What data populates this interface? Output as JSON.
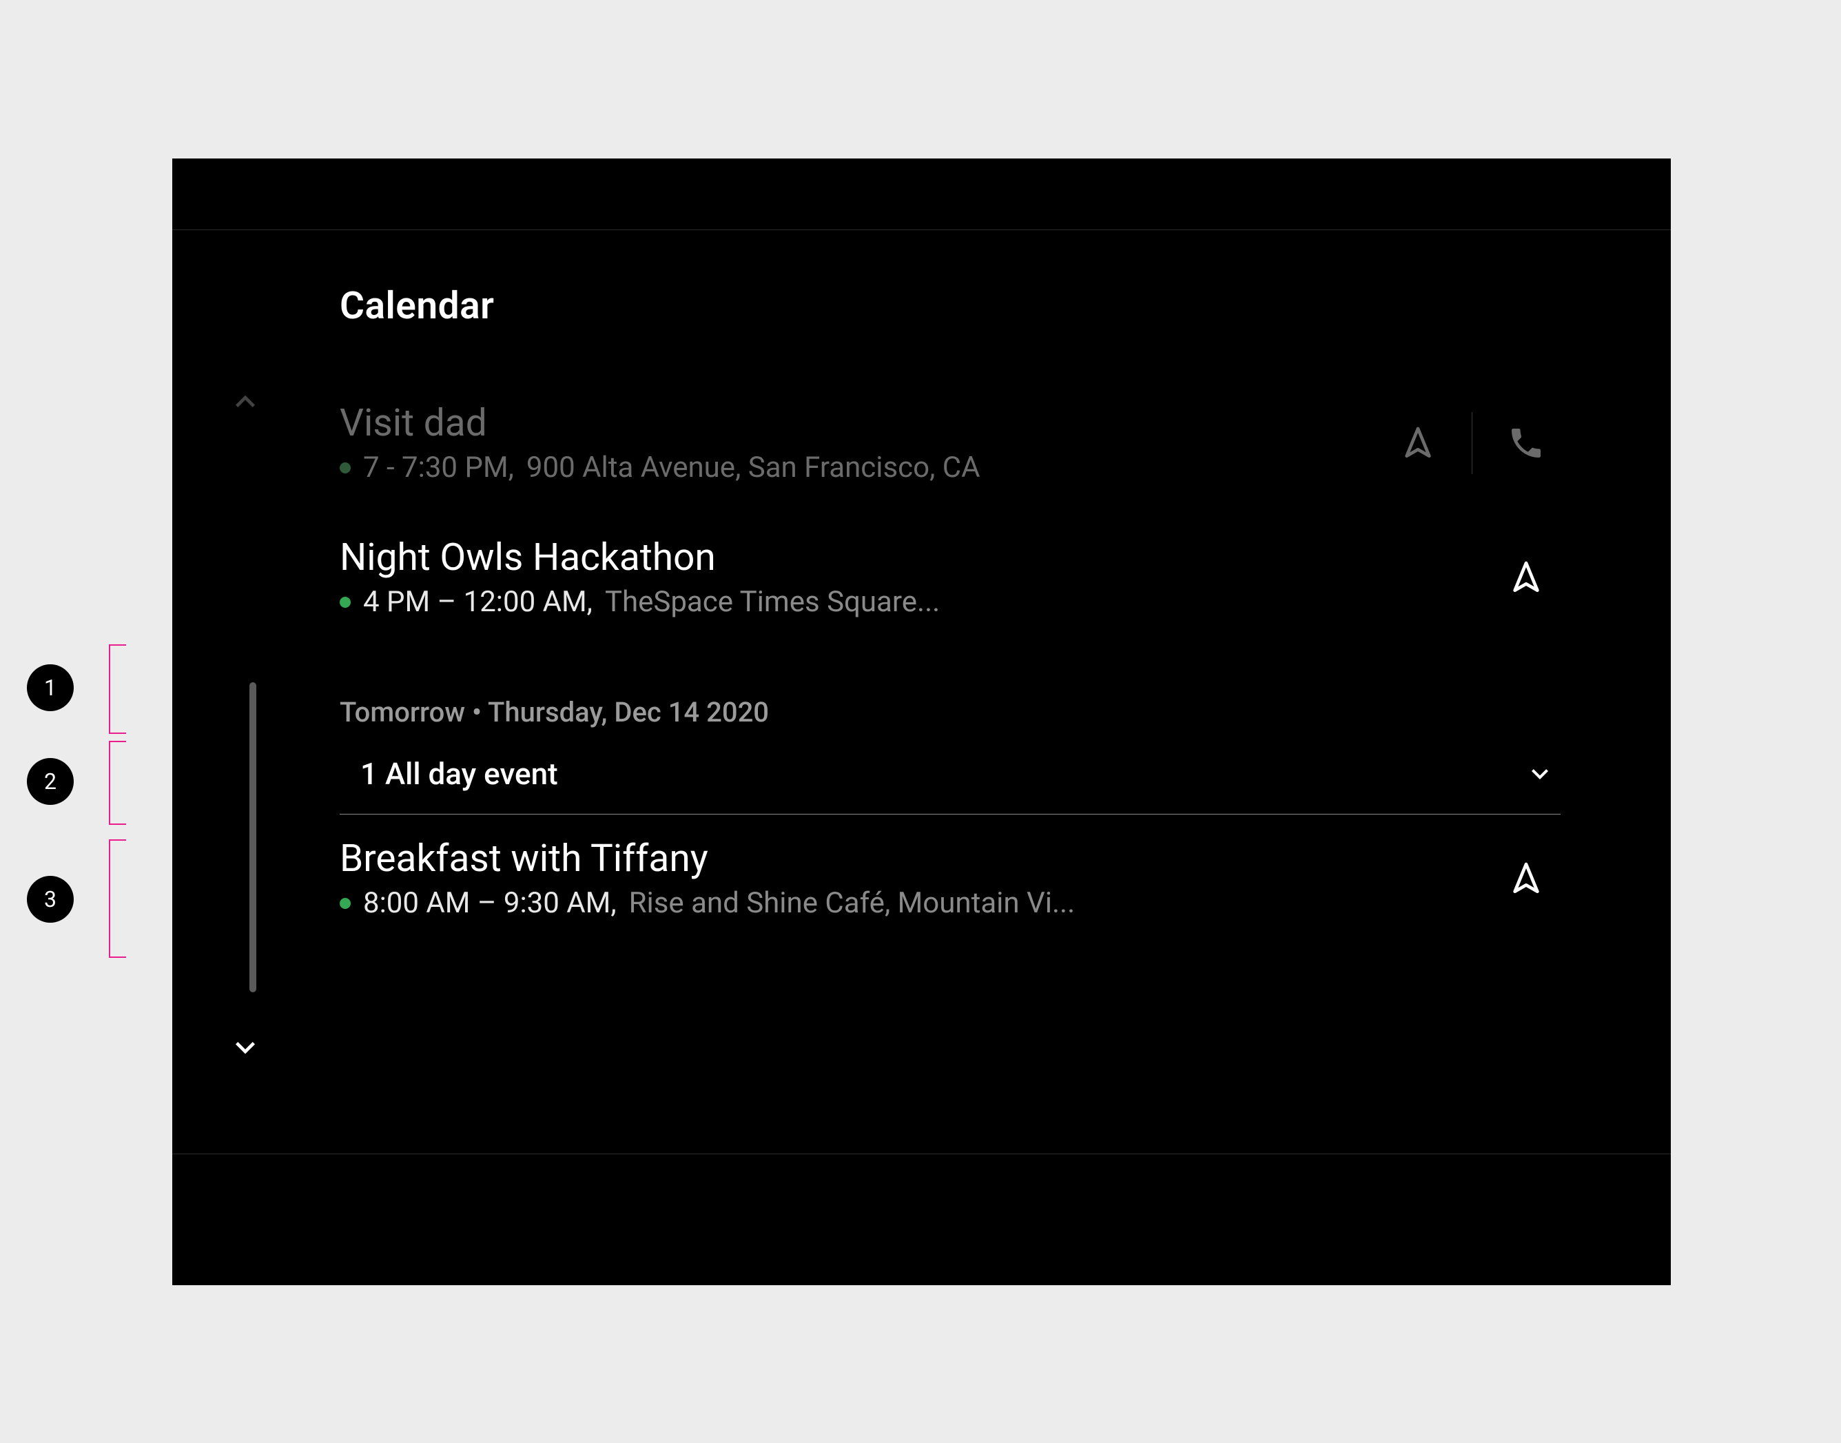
{
  "header": {
    "title": "Calendar"
  },
  "section": {
    "tomorrow_label": "Tomorrow • Thursday, Dec 14 2020"
  },
  "allday": {
    "label": "1 All day event"
  },
  "events": [
    {
      "title": "Visit dad",
      "time": "7 - 7:30 PM,",
      "location": "900 Alta Avenue, San Francisco, CA",
      "dimmed": true,
      "has_phone": true,
      "dot_color": "#2e5a3a"
    },
    {
      "title": "Night Owls Hackathon",
      "time": "4 PM – 12:00 AM,",
      "location": "TheSpace Times Square...",
      "dimmed": false,
      "has_phone": false,
      "dot_color": "#34A853"
    },
    {
      "title": "Breakfast with Tiffany",
      "time": "8:00 AM – 9:30 AM,",
      "location": "Rise and Shine Café, Mountain Vi...",
      "dimmed": false,
      "has_phone": false,
      "dot_color": "#34A853"
    }
  ],
  "annotations": {
    "a1": "1",
    "a2": "2",
    "a3": "3"
  },
  "colors": {
    "accent_green": "#34A853",
    "annotation_pink": "#E91E8C"
  }
}
